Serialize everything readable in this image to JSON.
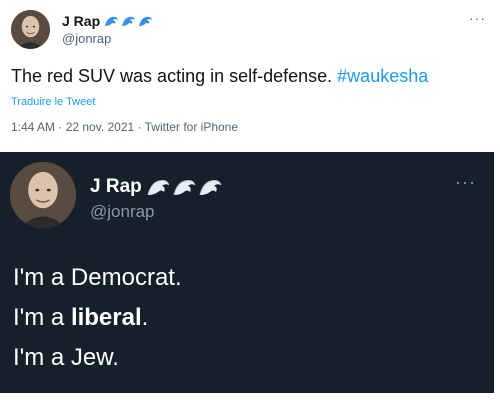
{
  "top_tweet": {
    "display_name": "J Rap",
    "handle": "@jonrap",
    "more": "···",
    "text_before": "The red SUV was acting in self-defense.",
    "hashtag": "#waukesha",
    "translate_label": "Traduire le Tweet",
    "meta": "1:44 AM · 22 nov. 2021 · Twitter for iPhone",
    "name_emoji": "water-wave-icon x3"
  },
  "bottom_tweet": {
    "display_name": "J Rap",
    "handle": "@jonrap",
    "more": "···",
    "line1": "I'm a Democrat.",
    "line2_prefix": "I'm a",
    "line2_bold": "liberal",
    "line2_suffix": ".",
    "line3": "I'm a Jew.",
    "name_emoji": "water-wave-icon x3"
  },
  "colors": {
    "link": "#1d9bf0",
    "dark_background": "#15202b",
    "light_background": "#ffffff",
    "secondary_text_light": "#536471",
    "secondary_text_dark": "#8899a6"
  }
}
